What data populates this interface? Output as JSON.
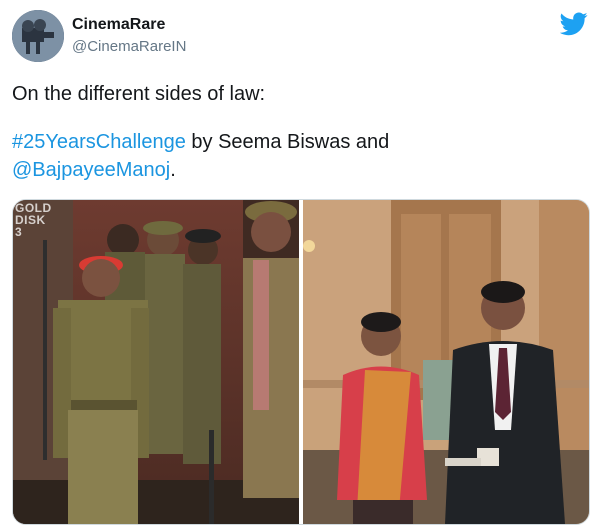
{
  "author": {
    "name": "CinemaRare",
    "handle": "@CinemaRareIN"
  },
  "tweet": {
    "line1": "On the different sides of law:",
    "hashtag": "#25YearsChallenge",
    "middle": " by Seema Biswas and",
    "mention": "@BajpayeeManoj",
    "end": "."
  },
  "media": {
    "left_watermark": "GOLD\nDISK\n3"
  },
  "icons": {
    "platform": "twitter-bird-icon"
  },
  "colors": {
    "link": "#1b95e0",
    "handle": "#657786",
    "twitter_blue": "#1da1f2"
  }
}
